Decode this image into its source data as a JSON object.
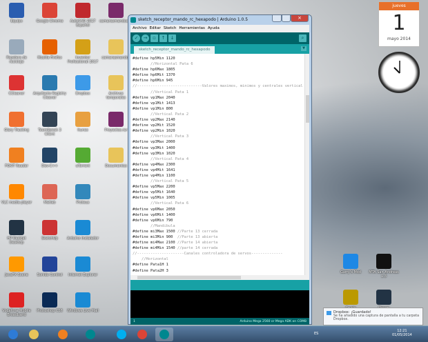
{
  "desktop": {
    "icons": [
      {
        "label": "Equipo",
        "color": "#2a5db0"
      },
      {
        "label": "Google Chrome",
        "color": "#db4437"
      },
      {
        "label": "AutoCAD 2017 Español",
        "color": "#c0282d"
      },
      {
        "label": "camarasmandos.zip",
        "color": "#7a2a6a"
      },
      {
        "label": "Papelera de reciclaje",
        "color": "#9ab"
      },
      {
        "label": "Mozilla Firefox",
        "color": "#e66000"
      },
      {
        "label": "Inventor Professional 2017",
        "color": "#d4a017"
      },
      {
        "label": "camarasmandos",
        "color": "#e8c45a"
      },
      {
        "label": "CCleaner",
        "color": "#d33"
      },
      {
        "label": "Arquitecto Registry Cleaner",
        "color": "#2a7ab0"
      },
      {
        "label": "Dropbox",
        "color": "#3d9ae8"
      },
      {
        "label": "Archivos temporales",
        "color": "#e8c45a"
      },
      {
        "label": "Glary Tracking",
        "color": "#f07030"
      },
      {
        "label": "TeamSpeak 3 Client",
        "color": "#345"
      },
      {
        "label": "Itunes",
        "color": "#e8a040"
      },
      {
        "label": "Proyectos.rar",
        "color": "#7a2a6a"
      },
      {
        "label": "FOXIT Reader",
        "color": "#f08020"
      },
      {
        "label": "Dev-C++",
        "color": "#246"
      },
      {
        "label": "uTorrent",
        "color": "#5a3"
      },
      {
        "label": "Documentos",
        "color": "#e8c45a"
      },
      {
        "label": "VLC media player",
        "color": "#f80"
      },
      {
        "label": "Matlab",
        "color": "#d65"
      },
      {
        "label": "Proteus",
        "color": "#38b"
      },
      {
        "label": "HP Deskjet Desktop",
        "color": "#234"
      },
      {
        "label": "SketchUp",
        "color": "#c33"
      },
      {
        "label": "Arduino Instalador",
        "color": "#1a8ad4"
      },
      {
        "label": "JavaFX Scene",
        "color": "#f90"
      },
      {
        "label": "Sonido Control",
        "color": "#249"
      },
      {
        "label": "Internet Explorer",
        "color": "#1a8ad4"
      },
      {
        "label": "Vodafone Mobile Broadband",
        "color": "#d22"
      },
      {
        "label": "Photoshop CS6",
        "color": "#0a2a55"
      },
      {
        "label": "Windows Live Mail",
        "color": "#1a8ad4"
      },
      {
        "label": "Garry's Mod",
        "color": "#1e88e5"
      },
      {
        "label": "MTA San Andreas 1.3",
        "color": "#111"
      },
      {
        "label": "Crysis",
        "color": "#b90"
      },
      {
        "label": "Steam",
        "color": "#234"
      }
    ]
  },
  "calendar": {
    "weekday": "jueves",
    "day": "1",
    "month_year": "mayo 2014"
  },
  "arduino": {
    "title": "sketch_receptor_mando_rc_hexapodo | Arduino 1.0.5",
    "menu": [
      "Archivo",
      "Editar",
      "Sketch",
      "Herramientas",
      "Ayuda"
    ],
    "tab": "sketch_receptor_mando_rc_hexapodo",
    "code": [
      {
        "t": "#define hp5Min 1120"
      },
      {
        "t": "        //Horizontal Pata 6",
        "c": 1
      },
      {
        "t": "#define hp6Max 1805"
      },
      {
        "t": "#define hp6Mit 1370"
      },
      {
        "t": "#define hp6Min 945"
      },
      {
        "t": "//-----------------------------Valores maximos, minimos y centrales vertical",
        "c": 1
      },
      {
        "t": "        //Vertical Pata 1",
        "c": 1
      },
      {
        "t": "#define vp1Max 2040"
      },
      {
        "t": "#define vp1Mit 1413"
      },
      {
        "t": "#define vp1Min 800"
      },
      {
        "t": "        //Vertical Pata 2",
        "c": 1
      },
      {
        "t": "#define vp2Max 2140"
      },
      {
        "t": "#define vp2Mit 1520"
      },
      {
        "t": "#define vp2Min 1020"
      },
      {
        "t": "        //Vertical Pata 3",
        "c": 1
      },
      {
        "t": "#define vp3Max 2000"
      },
      {
        "t": "#define vp3Mit 1400"
      },
      {
        "t": "#define vp3Min 1020"
      },
      {
        "t": "        //Vertical Pata 4",
        "c": 1
      },
      {
        "t": "#define vp4Max 2300"
      },
      {
        "t": "#define vp4Mit 1641"
      },
      {
        "t": "#define vp4Min 1100"
      },
      {
        "t": "        //Vertical Pata 5",
        "c": 1
      },
      {
        "t": "#define vp5Max 2200"
      },
      {
        "t": "#define vp5Mit 1640"
      },
      {
        "t": "#define vp5Min 1005"
      },
      {
        "t": "        //Vertical Pata 6",
        "c": 1
      },
      {
        "t": "#define vp6Max 2050"
      },
      {
        "t": "#define vp6Mit 1400"
      },
      {
        "t": "#define vp6Min 790"
      },
      {
        "t": "        //Mandibula",
        "c": 1
      },
      {
        "t": "#define mi3Max 1500 ",
        "m": "//Parte 13 cerrada"
      },
      {
        "t": "#define mi3Min 900  ",
        "m": "//Parte 13 abierta"
      },
      {
        "t": "#define mi4Max 2100 ",
        "m": "//Parte 14 abierta"
      },
      {
        "t": "#define mi4Min 1540 ",
        "m": "//parte 14 cerrada"
      },
      {
        "t": "//---------------------Canales controladora de servos--------------",
        "c": 1
      },
      {
        "t": "    //Horizontal",
        "c": 1
      },
      {
        "t": "#define Pata1H 1"
      },
      {
        "t": "#define Pata2H 3"
      }
    ],
    "status_line": "1",
    "board": "Arduino Mega 2560 or Mega ADK on COM8"
  },
  "notification": {
    "title": "Dropbox: ¡Guardado!",
    "body": "Se ha añadido una captura de pantalla a tu carpeta Dropbox."
  },
  "taskbar": {
    "items": [
      {
        "name": "start",
        "color": "#2e7bd6"
      },
      {
        "name": "explorer",
        "color": "#e8c45a"
      },
      {
        "name": "media-player",
        "color": "#f08020"
      },
      {
        "name": "arduino",
        "color": "#00878f"
      },
      {
        "name": "skype",
        "color": "#00aff0"
      },
      {
        "name": "chrome",
        "color": "#db4437"
      },
      {
        "name": "arduino-ide",
        "color": "#00878f"
      }
    ],
    "lang": "ES",
    "time": "12:21",
    "date": "01/05/2014"
  }
}
